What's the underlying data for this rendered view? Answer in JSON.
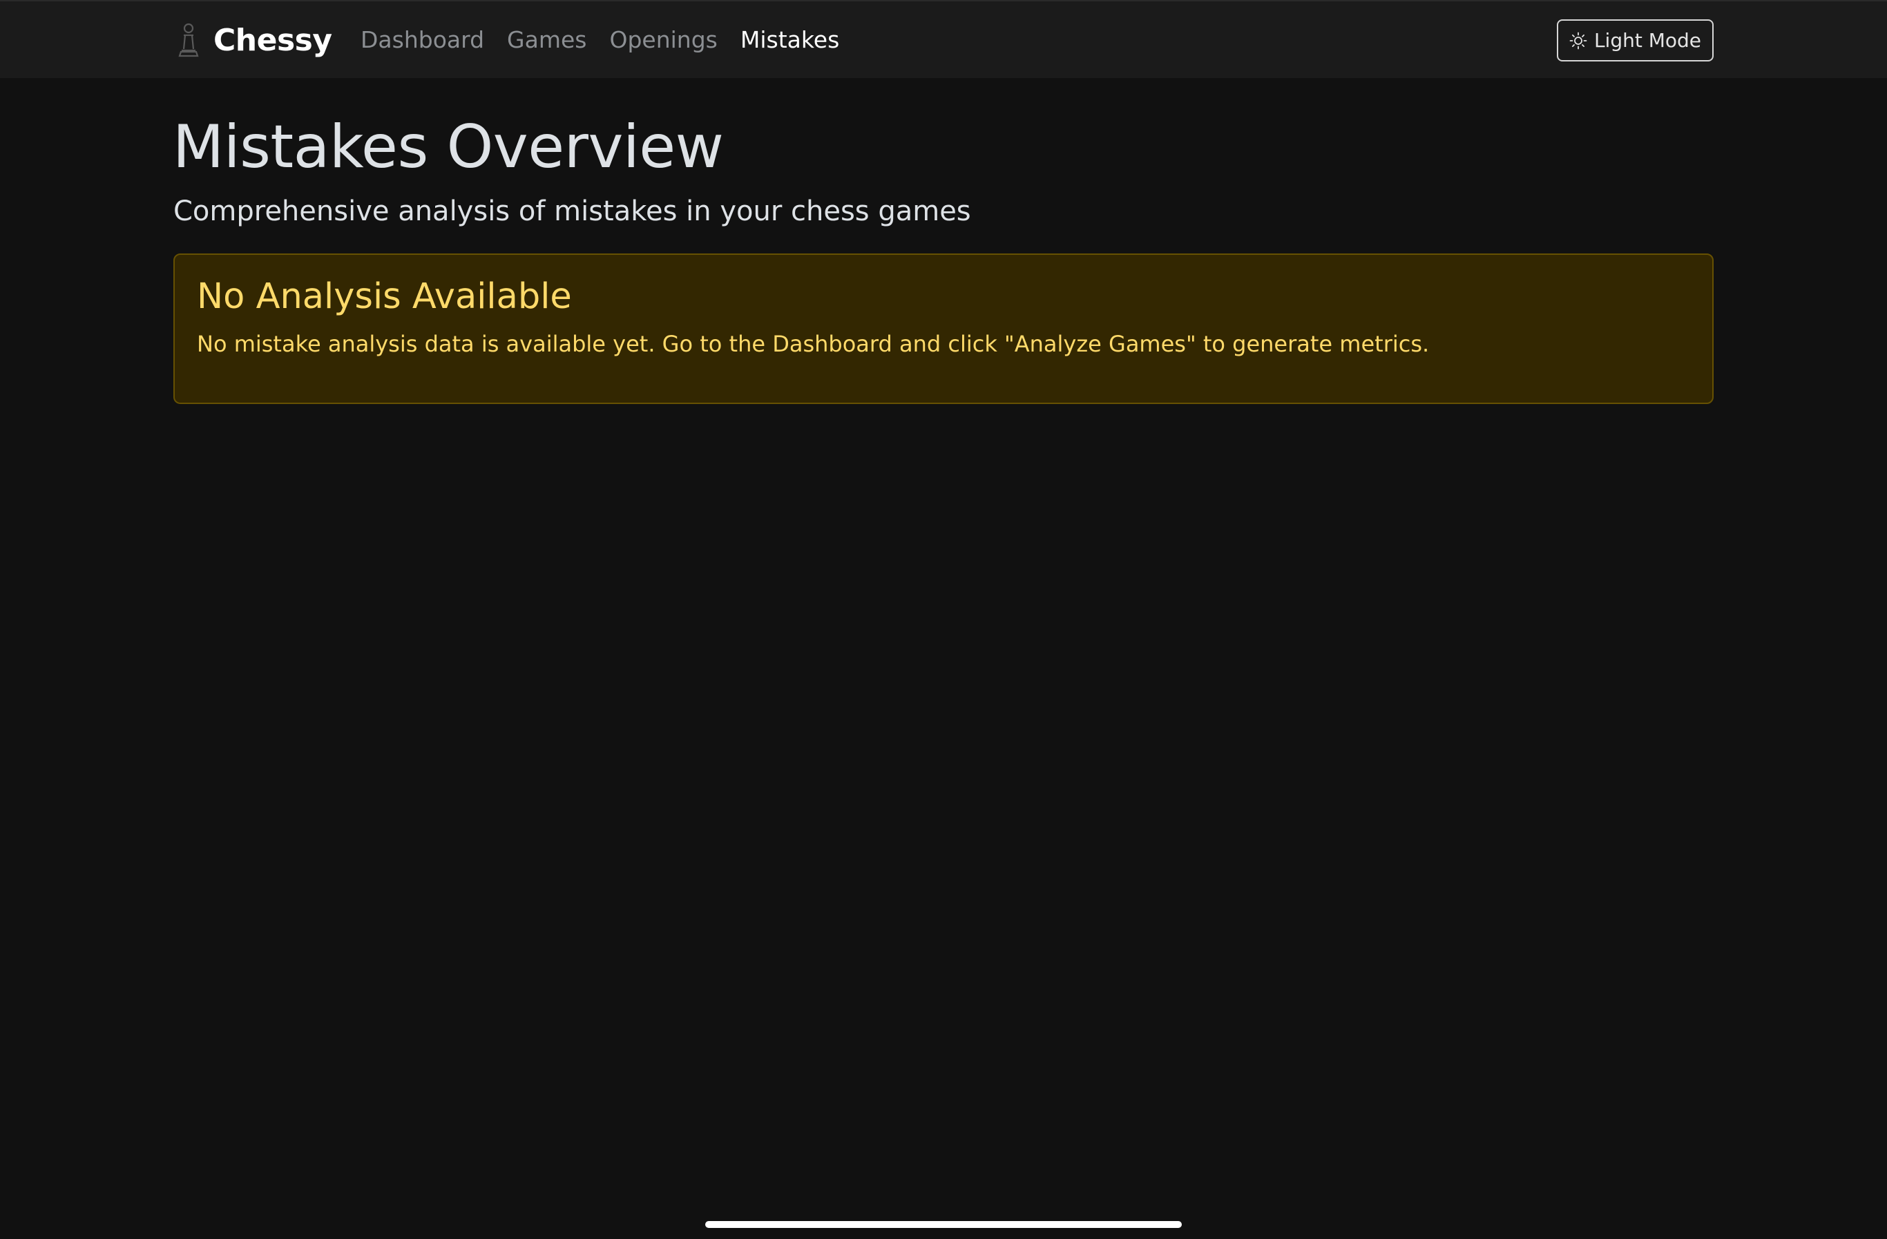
{
  "app": {
    "brand_name": "Chessy",
    "brand_icon": "chess-pawn-icon"
  },
  "nav": {
    "items": [
      {
        "label": "Dashboard",
        "active": false
      },
      {
        "label": "Games",
        "active": false
      },
      {
        "label": "Openings",
        "active": false
      },
      {
        "label": "Mistakes",
        "active": true
      }
    ]
  },
  "theme_toggle": {
    "label": "Light Mode",
    "icon": "sun-icon"
  },
  "page": {
    "title": "Mistakes Overview",
    "subtitle": "Comprehensive analysis of mistakes in your chess games"
  },
  "alert": {
    "heading": "No Analysis Available",
    "message": "No mistake analysis data is available yet. Go to the Dashboard and click \"Analyze Games\" to generate metrics."
  },
  "colors": {
    "background": "#111111",
    "navbar": "#1b1b1b",
    "alert_bg": "#332701",
    "alert_border": "#665102",
    "alert_text": "#ffda6a",
    "nav_inactive": "#8c8f93",
    "nav_active": "#ffffff"
  }
}
